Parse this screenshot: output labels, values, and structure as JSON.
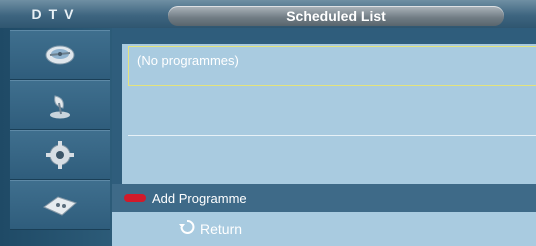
{
  "header": {
    "mode_label": "DTV",
    "title": "Scheduled List"
  },
  "sidebar": {
    "items": [
      {
        "icon": "satellite-dish-icon"
      },
      {
        "icon": "antenna-icon"
      },
      {
        "icon": "gear-icon"
      },
      {
        "icon": "remote-control-icon"
      }
    ]
  },
  "list": {
    "empty_text": "(No programmes)"
  },
  "actions": {
    "add_label": "Add Programme",
    "add_key_color": "#d11a2a"
  },
  "footer": {
    "return_label": "Return",
    "return_icon": "return-arrow-icon"
  }
}
